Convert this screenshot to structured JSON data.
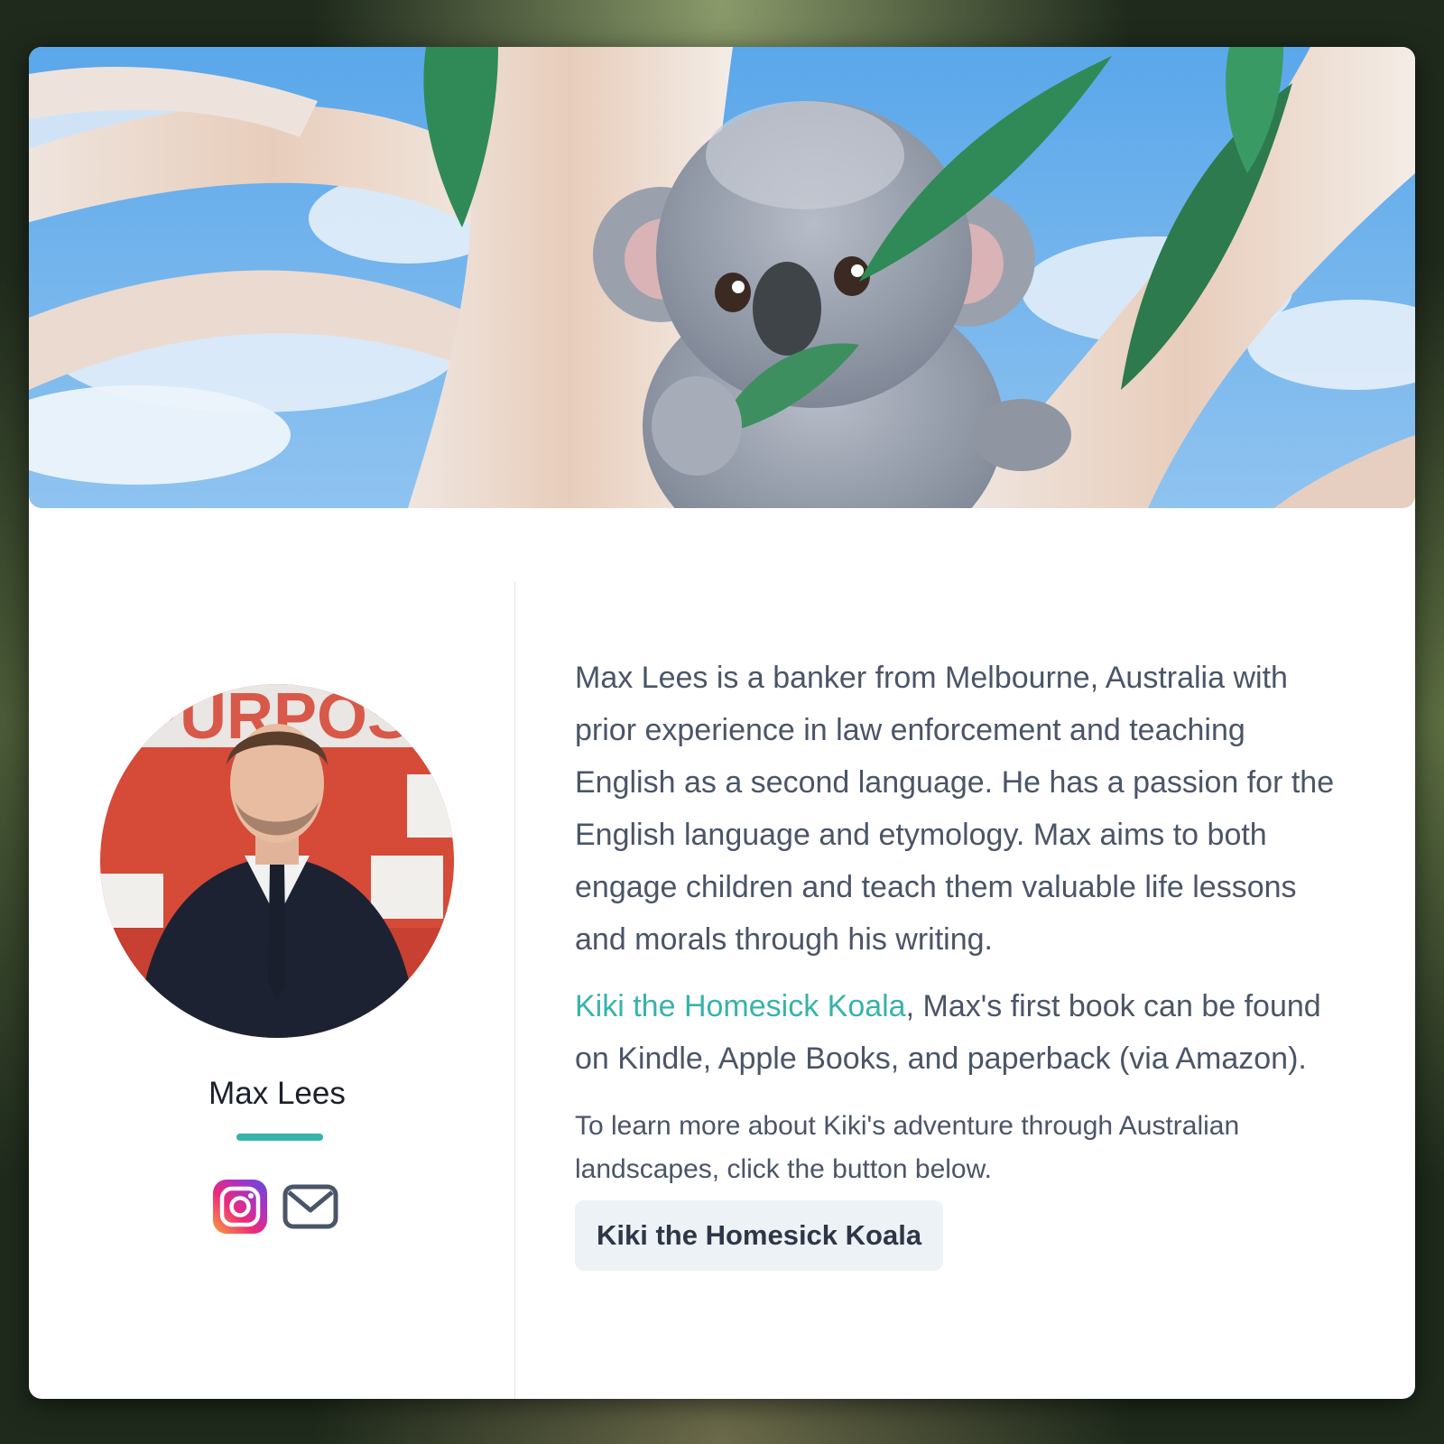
{
  "hero": {
    "illustration_icon": "koala-in-eucalyptus-tree-illustration"
  },
  "author": {
    "name": "Max Lees",
    "photo_icon": "author-portrait-photo",
    "accent_color": "#38b2ac"
  },
  "social": {
    "instagram_icon": "instagram-icon",
    "email_icon": "mail-icon"
  },
  "bio": {
    "paragraph1": "Max Lees is a banker from Melbourne, Australia with prior experience in law enforcement and teaching English as a second language. He has a passion for the English language and etymology. Max aims to both engage children and teach them valuable life lessons and morals through his writing.",
    "book_link_text": "Kiki the Homesick Koala",
    "paragraph2_rest": ", Max's first book can be found on Kindle, Apple Books, and paperback (via Amazon).",
    "learn_more": "To learn more about Kiki's adventure through Australian landscapes, click the button below."
  },
  "cta": {
    "label": "Kiki the Homesick Koala"
  },
  "colors": {
    "link": "#38b2ac",
    "text": "#4a5568",
    "heading": "#1a202c",
    "button_bg": "#edf2f7"
  }
}
